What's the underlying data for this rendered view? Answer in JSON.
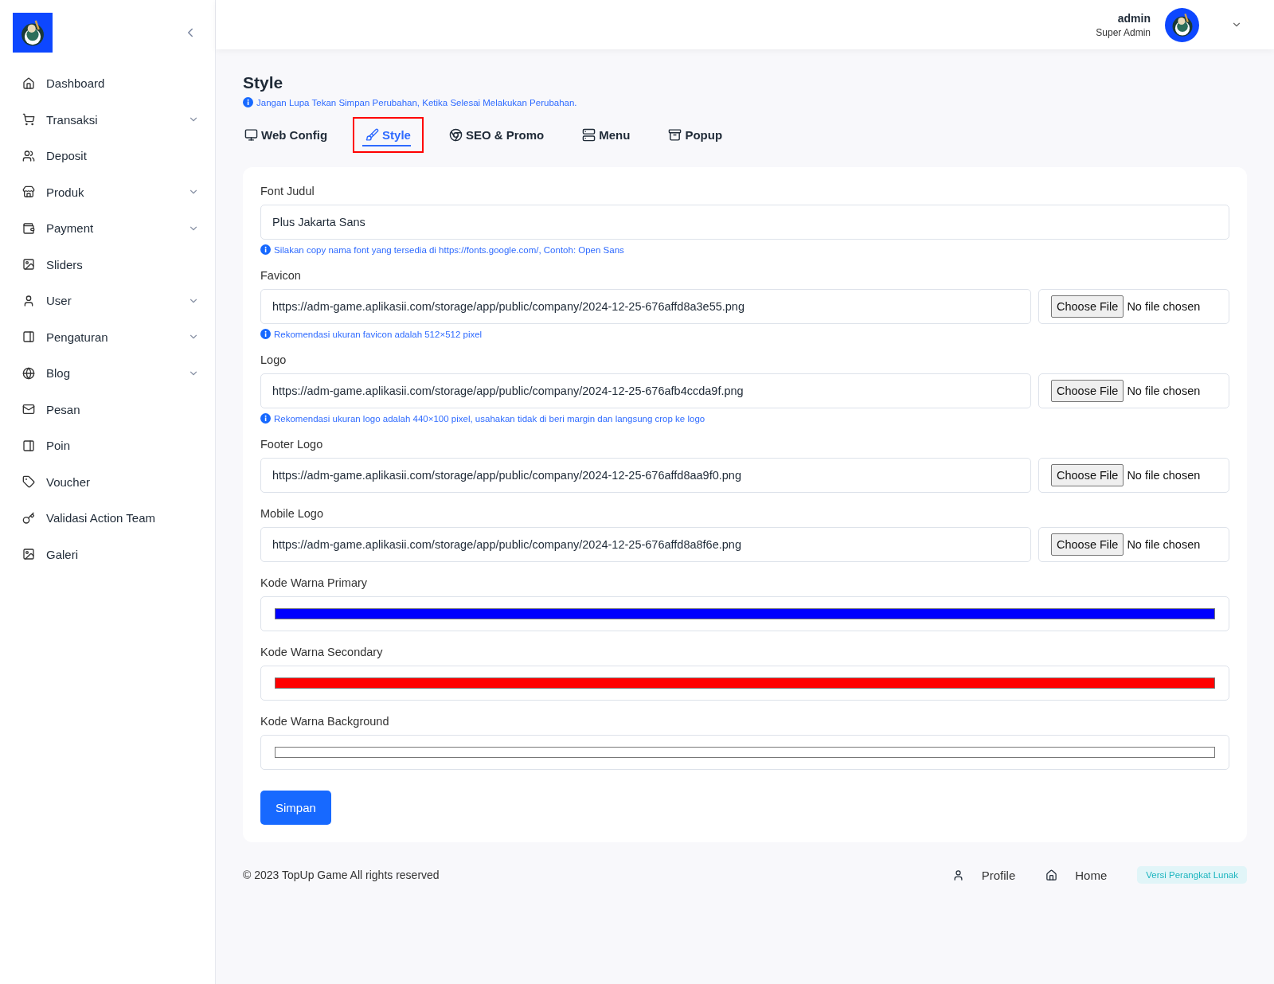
{
  "sidebar": {
    "items": [
      {
        "label": "Dashboard",
        "expandable": false
      },
      {
        "label": "Transaksi",
        "expandable": true
      },
      {
        "label": "Deposit",
        "expandable": false
      },
      {
        "label": "Produk",
        "expandable": true
      },
      {
        "label": "Payment",
        "expandable": true
      },
      {
        "label": "Sliders",
        "expandable": false
      },
      {
        "label": "User",
        "expandable": true
      },
      {
        "label": "Pengaturan",
        "expandable": true
      },
      {
        "label": "Blog",
        "expandable": true
      },
      {
        "label": "Pesan",
        "expandable": false
      },
      {
        "label": "Poin",
        "expandable": false
      },
      {
        "label": "Voucher",
        "expandable": false
      },
      {
        "label": "Validasi Action Team",
        "expandable": false
      },
      {
        "label": "Galeri",
        "expandable": false
      }
    ]
  },
  "user": {
    "name": "admin",
    "role": "Super Admin"
  },
  "page": {
    "title": "Style",
    "notice": "Jangan Lupa Tekan Simpan Perubahan, Ketika Selesai Melakukan Perubahan."
  },
  "tabs": [
    {
      "label": "Web Config",
      "selected": false,
      "highlighted": false
    },
    {
      "label": "Style",
      "selected": true,
      "highlighted": true
    },
    {
      "label": "SEO & Promo",
      "selected": false,
      "highlighted": false
    },
    {
      "label": "Menu",
      "selected": false,
      "highlighted": false
    },
    {
      "label": "Popup",
      "selected": false,
      "highlighted": false
    }
  ],
  "fields": [
    {
      "kind": "text",
      "label": "Font Judul",
      "value": "Plus Jakarta Sans",
      "hint": "Silakan copy nama font yang tersedia di https://fonts.google.com/, Contoh: Open Sans"
    },
    {
      "kind": "file",
      "label": "Favicon",
      "value": "https://adm-game.aplikasii.com/storage/app/public/company/2024-12-25-676affd8a3e55.png",
      "button": "Choose File",
      "status": "No file chosen",
      "hint": "Rekomendasi ukuran favicon adalah 512×512 pixel"
    },
    {
      "kind": "file",
      "label": "Logo",
      "value": "https://adm-game.aplikasii.com/storage/app/public/company/2024-12-25-676afb4ccda9f.png",
      "button": "Choose File",
      "status": "No file chosen",
      "hint": "Rekomendasi ukuran logo adalah 440×100 pixel, usahakan tidak di beri margin dan langsung crop ke logo"
    },
    {
      "kind": "file",
      "label": "Footer Logo",
      "value": "https://adm-game.aplikasii.com/storage/app/public/company/2024-12-25-676affd8aa9f0.png",
      "button": "Choose File",
      "status": "No file chosen"
    },
    {
      "kind": "file",
      "label": "Mobile Logo",
      "value": "https://adm-game.aplikasii.com/storage/app/public/company/2024-12-25-676affd8a8f6e.png",
      "button": "Choose File",
      "status": "No file chosen"
    },
    {
      "kind": "color",
      "label": "Kode Warna Primary",
      "color": "#0000ff"
    },
    {
      "kind": "color",
      "label": "Kode Warna Secondary",
      "color": "#ff0000"
    },
    {
      "kind": "color",
      "label": "Kode Warna Background",
      "color": "#ffffff"
    }
  ],
  "save_button": "Simpan",
  "footer": {
    "copyright": "© 2023 TopUp Game All rights reserved",
    "links": [
      "Profile",
      "Home"
    ],
    "badge": "Versi Perangkat Lunak"
  }
}
